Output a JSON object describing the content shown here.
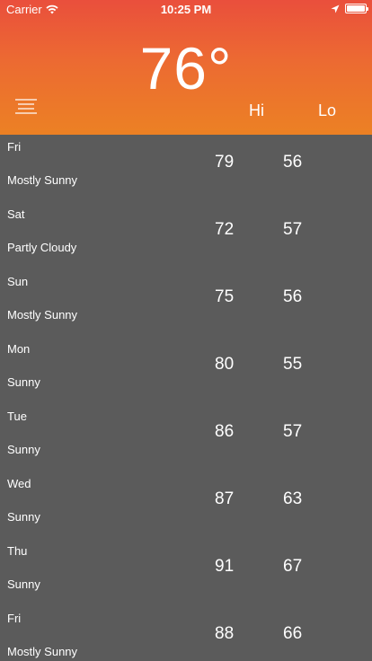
{
  "status_bar": {
    "carrier": "Carrier",
    "time": "10:25 PM"
  },
  "header": {
    "current_temp": "76°",
    "hi_label": "Hi",
    "lo_label": "Lo"
  },
  "icons": {
    "wifi": "wifi-icon",
    "location": "location-arrow-icon",
    "battery": "battery-icon",
    "menu": "hamburger-menu-icon"
  },
  "colors": {
    "header_gradient_top": "#ea4f3c",
    "header_gradient_bottom": "#ec8124",
    "list_background": "#5b5b5b",
    "text": "#ffffff"
  },
  "forecast": [
    {
      "day": "Fri",
      "condition": "Mostly Sunny",
      "hi": "79",
      "lo": "56"
    },
    {
      "day": "Sat",
      "condition": "Partly Cloudy",
      "hi": "72",
      "lo": "57"
    },
    {
      "day": "Sun",
      "condition": "Mostly Sunny",
      "hi": "75",
      "lo": "56"
    },
    {
      "day": "Mon",
      "condition": "Sunny",
      "hi": "80",
      "lo": "55"
    },
    {
      "day": "Tue",
      "condition": "Sunny",
      "hi": "86",
      "lo": "57"
    },
    {
      "day": "Wed",
      "condition": "Sunny",
      "hi": "87",
      "lo": "63"
    },
    {
      "day": "Thu",
      "condition": "Sunny",
      "hi": "91",
      "lo": "67"
    },
    {
      "day": "Fri",
      "condition": "Mostly Sunny",
      "hi": "88",
      "lo": "66"
    }
  ]
}
